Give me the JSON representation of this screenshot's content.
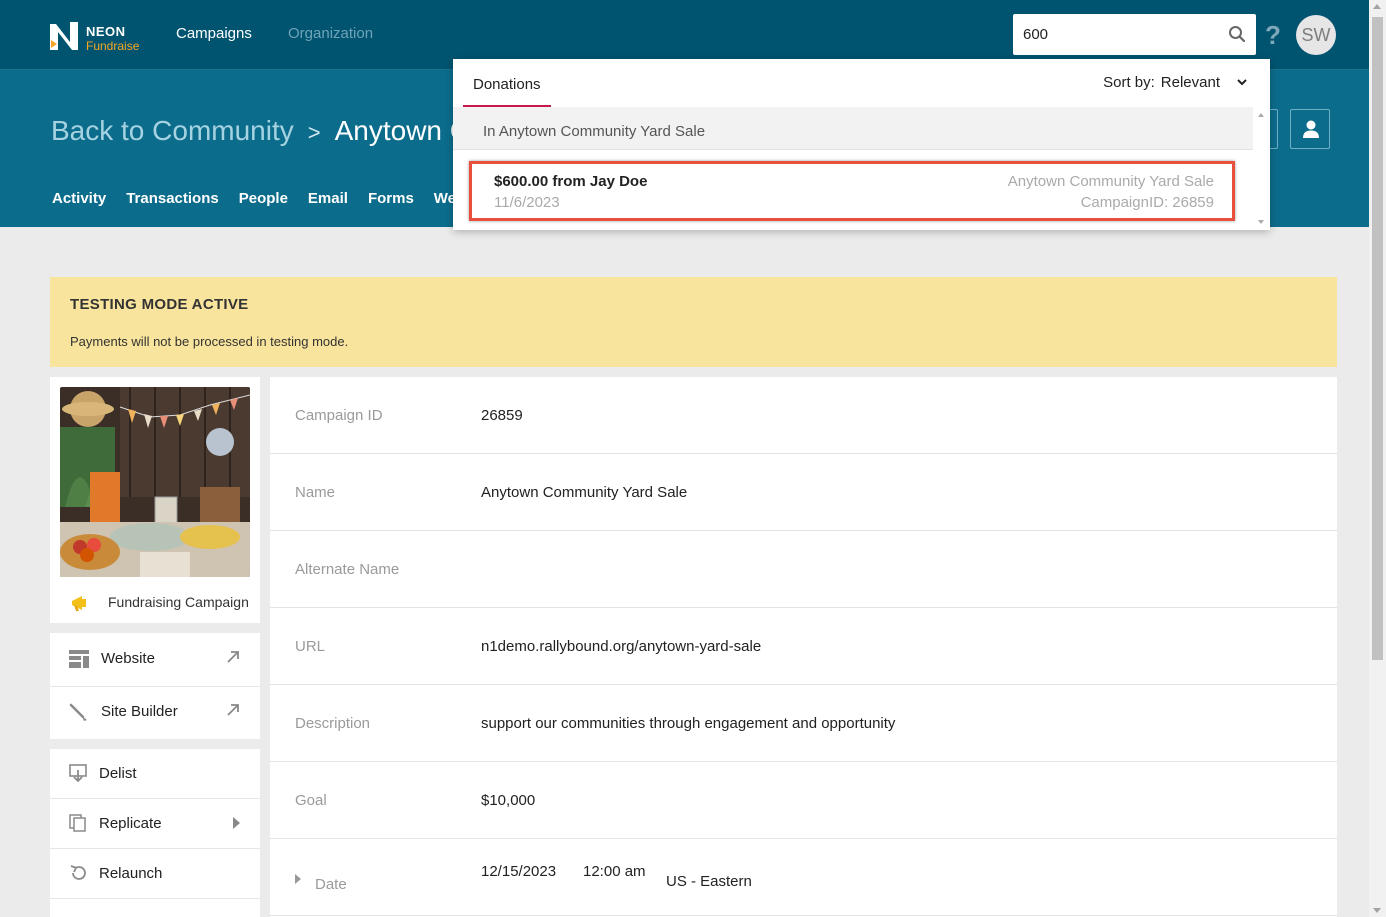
{
  "topbar": {
    "logo_line1": "NEON",
    "logo_line2": "Fundraise",
    "nav": [
      {
        "label": "Campaigns"
      },
      {
        "label": "Organization"
      }
    ],
    "search_value": "600",
    "help_label": "?",
    "avatar_initials": "SW"
  },
  "header": {
    "breadcrumb_back": "Back to Community",
    "breadcrumb_sep": ">",
    "breadcrumb_current": "Anytown C",
    "subnav": [
      "Activity",
      "Transactions",
      "People",
      "Email",
      "Forms",
      "We"
    ]
  },
  "banner": {
    "title": "TESTING MODE ACTIVE",
    "text": "Payments will not be processed in testing mode."
  },
  "campaign_card": {
    "type_label": "Fundraising Campaign"
  },
  "links": [
    {
      "label": "Website"
    },
    {
      "label": "Site Builder"
    }
  ],
  "actions": [
    {
      "label": "Delist"
    },
    {
      "label": "Replicate"
    },
    {
      "label": "Relaunch"
    }
  ],
  "details": [
    {
      "key": "Campaign ID",
      "value": "26859"
    },
    {
      "key": "Name",
      "value": "Anytown Community Yard Sale"
    },
    {
      "key": "Alternate Name",
      "value": ""
    },
    {
      "key": "URL",
      "value": "n1demo.rallybound.org/anytown-yard-sale"
    },
    {
      "key": "Description",
      "value": "support our communities through engagement and opportunity"
    },
    {
      "key": "Goal",
      "value": "$10,000"
    }
  ],
  "date_row": {
    "key": "Date",
    "date": "12/15/2023",
    "time": "12:00 am",
    "timezone": "US - Eastern"
  },
  "dropdown": {
    "tab_label": "Donations",
    "sort_label": "Sort by:",
    "sort_value": "Relevant",
    "section_label": "In Anytown Community Yard Sale",
    "result": {
      "title": "$600.00 from Jay Doe",
      "date": "11/6/2023",
      "campaign": "Anytown Community Yard Sale",
      "campaign_id": "CampaignID: 26859"
    }
  },
  "colors": {
    "topbar": "#005470",
    "header": "#0c6c8c",
    "banner": "#f8e49c",
    "accent_tab": "#c8184a",
    "highlight": "#e84f3d"
  }
}
